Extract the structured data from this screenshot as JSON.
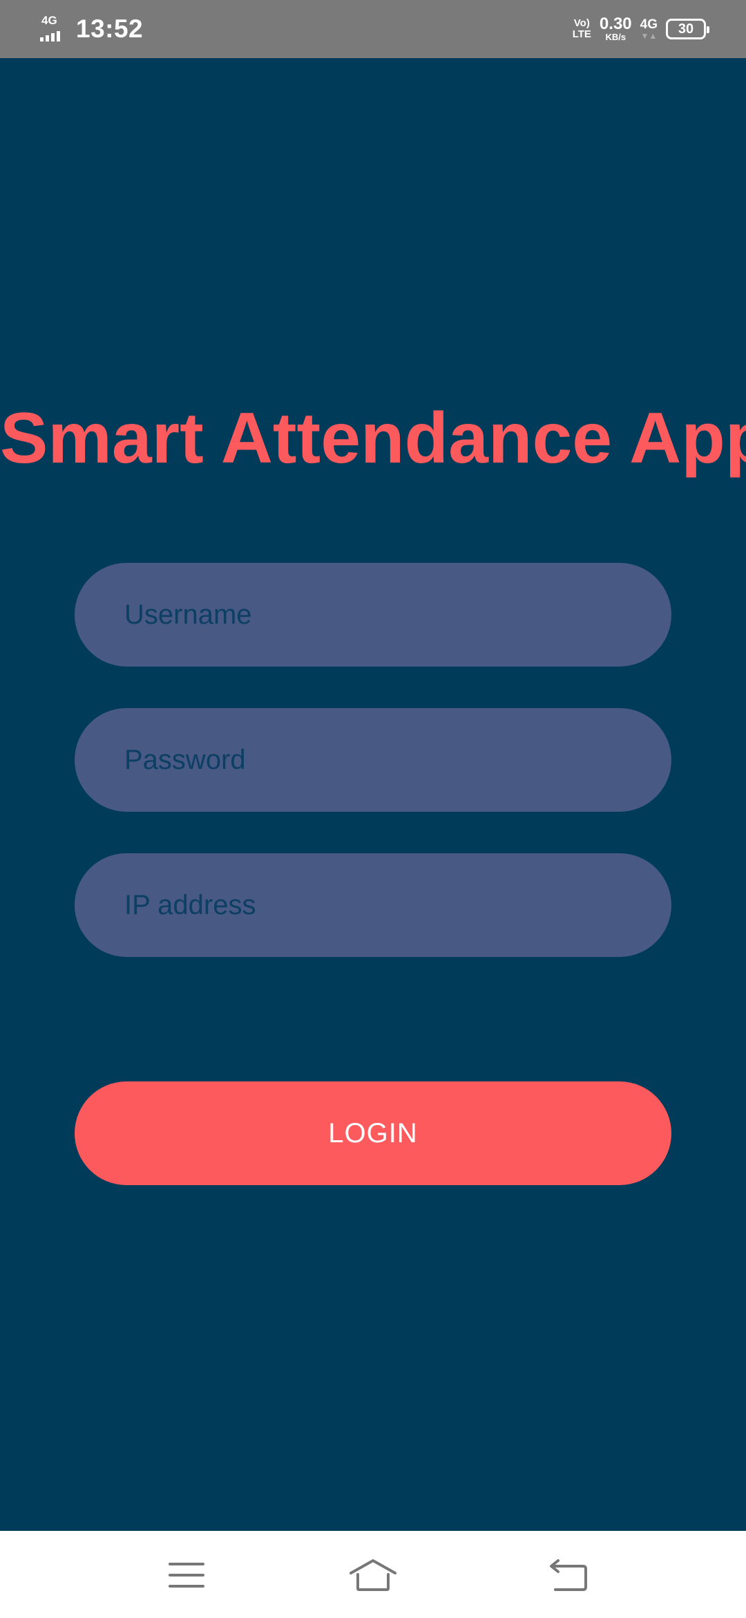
{
  "status_bar": {
    "network_type": "4G",
    "time": "13:52",
    "volte_top": "Vo)",
    "volte_bottom": "LTE",
    "speed_value": "0.30",
    "speed_unit": "KB/s",
    "network_type_2": "4G",
    "battery_level": "30",
    "icons": [
      "signal-icon",
      "battery-icon"
    ]
  },
  "app": {
    "title": "Smart Attendance App"
  },
  "form": {
    "username_placeholder": "Username",
    "password_placeholder": "Password",
    "ip_placeholder": "IP address",
    "login_label": "LOGIN"
  },
  "nav": {
    "icons": [
      "menu-icon",
      "home-icon",
      "back-icon"
    ]
  },
  "colors": {
    "background": "#003b5a",
    "accent": "#fc5a5c",
    "field_bg": "#485a84",
    "status_bar": "#7a7a7a"
  }
}
